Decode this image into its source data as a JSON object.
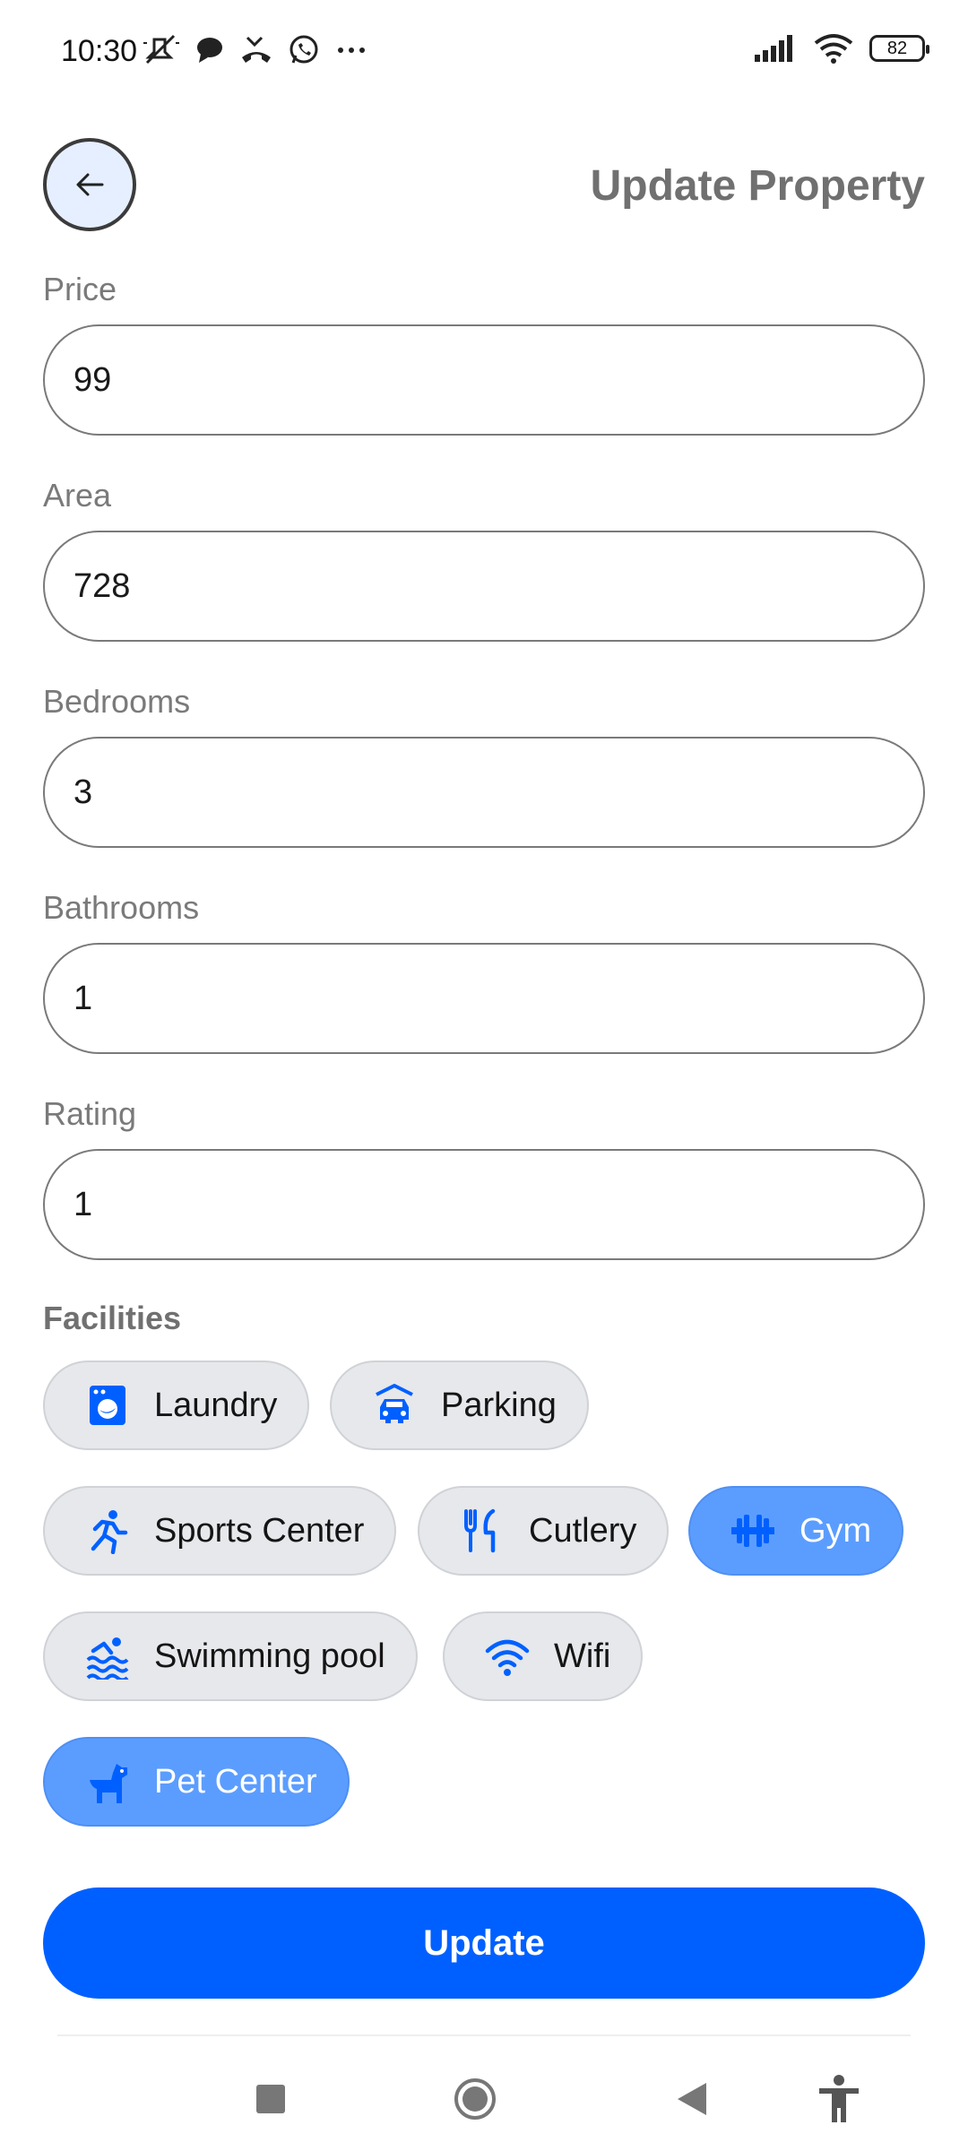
{
  "status_bar": {
    "time": "10:30",
    "battery": "82",
    "icons": [
      "mute-icon",
      "chat-icon",
      "missed-call-icon",
      "whatsapp-icon",
      "more-icon",
      "signal-icon",
      "wifi-icon",
      "battery-icon"
    ]
  },
  "header": {
    "title": "Update Property",
    "back_icon": "arrow-left-icon"
  },
  "form": {
    "price": {
      "label": "Price",
      "value": "99"
    },
    "area": {
      "label": "Area",
      "value": "728"
    },
    "bedrooms": {
      "label": "Bedrooms",
      "value": "3"
    },
    "bathrooms": {
      "label": "Bathrooms",
      "value": "1"
    },
    "rating": {
      "label": "Rating",
      "value": "1"
    }
  },
  "facilities": {
    "title": "Facilities",
    "items": [
      {
        "label": "Laundry",
        "icon": "laundry-icon",
        "selected": false
      },
      {
        "label": "Parking",
        "icon": "car-icon",
        "selected": false
      },
      {
        "label": "Sports Center",
        "icon": "running-icon",
        "selected": false
      },
      {
        "label": "Cutlery",
        "icon": "cutlery-icon",
        "selected": false
      },
      {
        "label": "Gym",
        "icon": "dumbbell-icon",
        "selected": true
      },
      {
        "label": "Swimming pool",
        "icon": "pool-icon",
        "selected": false
      },
      {
        "label": "Wifi",
        "icon": "wifi-icon",
        "selected": false
      },
      {
        "label": "Pet Center",
        "icon": "dog-icon",
        "selected": true
      }
    ]
  },
  "actions": {
    "update_label": "Update"
  },
  "colors": {
    "primary": "#0060ff",
    "chip_selected": "#5b9dff",
    "chip_bg": "#e6e8eb",
    "icon_blue": "#0060ff",
    "title_gray": "#707070"
  }
}
